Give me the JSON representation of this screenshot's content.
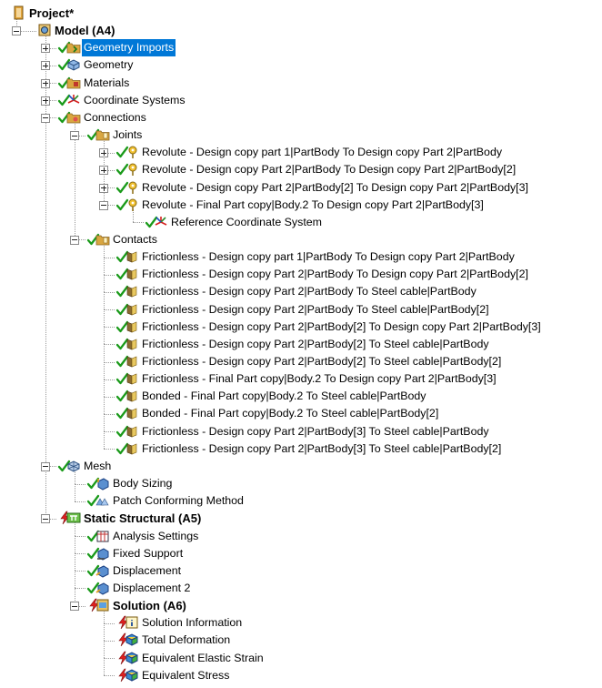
{
  "tree": [
    {
      "label": "Project*",
      "depth": 0,
      "icon": "project-icon",
      "expander": "none",
      "status": "none",
      "bold": true
    },
    {
      "label": "Model (A4)",
      "depth": 1,
      "icon": "model-icon",
      "expander": "minus",
      "status": "none",
      "bold": true
    },
    {
      "label": "Geometry Imports",
      "depth": 2,
      "icon": "geometry-imports-icon",
      "expander": "plus",
      "status": "check",
      "selected": true
    },
    {
      "label": "Geometry",
      "depth": 2,
      "icon": "geometry-icon",
      "expander": "plus",
      "status": "check"
    },
    {
      "label": "Materials",
      "depth": 2,
      "icon": "materials-icon",
      "expander": "plus",
      "status": "check"
    },
    {
      "label": "Coordinate Systems",
      "depth": 2,
      "icon": "coordinate-systems-icon",
      "expander": "plus",
      "status": "check"
    },
    {
      "label": "Connections",
      "depth": 2,
      "icon": "connections-icon",
      "expander": "minus",
      "status": "check"
    },
    {
      "label": "Joints",
      "depth": 3,
      "icon": "folder-icon",
      "expander": "minus",
      "status": "check"
    },
    {
      "label": "Revolute - Design copy part 1|PartBody To Design copy Part 2|PartBody",
      "depth": 4,
      "icon": "revolute-joint-icon",
      "expander": "plus",
      "status": "check"
    },
    {
      "label": "Revolute - Design copy Part 2|PartBody To Design copy Part 2|PartBody[2]",
      "depth": 4,
      "icon": "revolute-joint-icon",
      "expander": "plus",
      "status": "check"
    },
    {
      "label": "Revolute - Design copy Part 2|PartBody[2] To Design copy Part 2|PartBody[3]",
      "depth": 4,
      "icon": "revolute-joint-icon",
      "expander": "plus",
      "status": "check"
    },
    {
      "label": "Revolute - Final Part copy|Body.2 To Design copy Part 2|PartBody[3]",
      "depth": 4,
      "icon": "revolute-joint-icon",
      "expander": "minus",
      "status": "check"
    },
    {
      "label": "Reference Coordinate System",
      "depth": 5,
      "icon": "coordinate-system-icon",
      "expander": "none",
      "status": "check"
    },
    {
      "label": "Contacts",
      "depth": 3,
      "icon": "folder-icon",
      "expander": "minus",
      "status": "check"
    },
    {
      "label": "Frictionless - Design copy part 1|PartBody To Design copy Part 2|PartBody",
      "depth": 4,
      "icon": "contact-region-icon",
      "expander": "none",
      "status": "check"
    },
    {
      "label": "Frictionless - Design copy Part 2|PartBody To Design copy Part 2|PartBody[2]",
      "depth": 4,
      "icon": "contact-region-icon",
      "expander": "none",
      "status": "check"
    },
    {
      "label": "Frictionless - Design copy Part 2|PartBody To Steel cable|PartBody",
      "depth": 4,
      "icon": "contact-region-icon",
      "expander": "none",
      "status": "check"
    },
    {
      "label": "Frictionless - Design copy Part 2|PartBody To Steel cable|PartBody[2]",
      "depth": 4,
      "icon": "contact-region-icon",
      "expander": "none",
      "status": "check"
    },
    {
      "label": "Frictionless - Design copy Part 2|PartBody[2] To Design copy Part 2|PartBody[3]",
      "depth": 4,
      "icon": "contact-region-icon",
      "expander": "none",
      "status": "check"
    },
    {
      "label": "Frictionless - Design copy Part 2|PartBody[2] To Steel cable|PartBody",
      "depth": 4,
      "icon": "contact-region-icon",
      "expander": "none",
      "status": "check"
    },
    {
      "label": "Frictionless - Design copy Part 2|PartBody[2] To Steel cable|PartBody[2]",
      "depth": 4,
      "icon": "contact-region-icon",
      "expander": "none",
      "status": "check"
    },
    {
      "label": "Frictionless - Final Part copy|Body.2 To Design copy Part 2|PartBody[3]",
      "depth": 4,
      "icon": "contact-region-icon",
      "expander": "none",
      "status": "check"
    },
    {
      "label": "Bonded - Final Part copy|Body.2 To Steel cable|PartBody",
      "depth": 4,
      "icon": "contact-region-icon",
      "expander": "none",
      "status": "check"
    },
    {
      "label": "Bonded - Final Part copy|Body.2 To Steel cable|PartBody[2]",
      "depth": 4,
      "icon": "contact-region-icon",
      "expander": "none",
      "status": "check"
    },
    {
      "label": "Frictionless - Design copy Part 2|PartBody[3] To Steel cable|PartBody",
      "depth": 4,
      "icon": "contact-region-icon",
      "expander": "none",
      "status": "check"
    },
    {
      "label": "Frictionless - Design copy Part 2|PartBody[3] To Steel cable|PartBody[2]",
      "depth": 4,
      "icon": "contact-region-icon",
      "expander": "none",
      "status": "check"
    },
    {
      "label": "Mesh",
      "depth": 2,
      "icon": "mesh-icon",
      "expander": "minus",
      "status": "check"
    },
    {
      "label": "Body Sizing",
      "depth": 3,
      "icon": "body-sizing-icon",
      "expander": "none",
      "status": "check"
    },
    {
      "label": "Patch Conforming Method",
      "depth": 3,
      "icon": "patch-conforming-icon",
      "expander": "none",
      "status": "check"
    },
    {
      "label": "Static Structural (A5)",
      "depth": 2,
      "icon": "static-structural-icon",
      "expander": "minus",
      "status": "lightning",
      "bold": true
    },
    {
      "label": "Analysis Settings",
      "depth": 3,
      "icon": "analysis-settings-icon",
      "expander": "none",
      "status": "check"
    },
    {
      "label": "Fixed Support",
      "depth": 3,
      "icon": "fixed-support-icon",
      "expander": "none",
      "status": "check"
    },
    {
      "label": "Displacement",
      "depth": 3,
      "icon": "displacement-icon",
      "expander": "none",
      "status": "check"
    },
    {
      "label": "Displacement 2",
      "depth": 3,
      "icon": "displacement-icon",
      "expander": "none",
      "status": "check"
    },
    {
      "label": "Solution (A6)",
      "depth": 3,
      "icon": "solution-icon",
      "expander": "minus",
      "status": "lightning",
      "bold": true
    },
    {
      "label": "Solution Information",
      "depth": 4,
      "icon": "solution-information-icon",
      "expander": "none",
      "status": "lightning"
    },
    {
      "label": "Total Deformation",
      "depth": 4,
      "icon": "result-icon",
      "expander": "none",
      "status": "lightning"
    },
    {
      "label": "Equivalent Elastic Strain",
      "depth": 4,
      "icon": "result-icon",
      "expander": "none",
      "status": "lightning"
    },
    {
      "label": "Equivalent Stress",
      "depth": 4,
      "icon": "result-icon",
      "expander": "none",
      "status": "lightning"
    }
  ],
  "colors": {
    "check": "#1a9a1a",
    "lightning": "#e02020",
    "selection": "#0078d7",
    "folder": "#d9a640"
  }
}
